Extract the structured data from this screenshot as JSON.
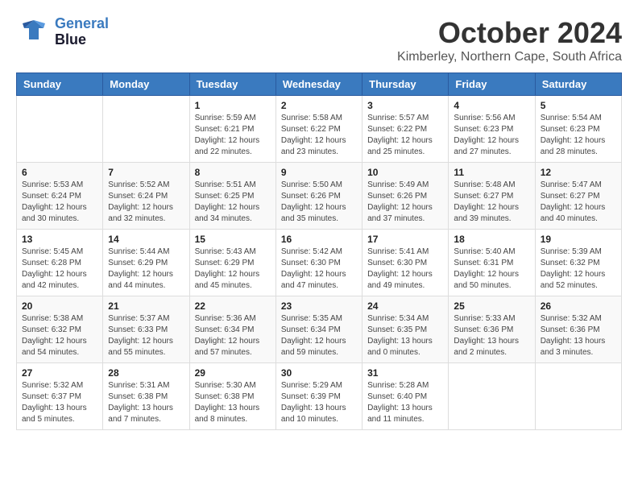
{
  "header": {
    "logo_line1": "General",
    "logo_line2": "Blue",
    "month": "October 2024",
    "location": "Kimberley, Northern Cape, South Africa"
  },
  "days_of_week": [
    "Sunday",
    "Monday",
    "Tuesday",
    "Wednesday",
    "Thursday",
    "Friday",
    "Saturday"
  ],
  "weeks": [
    [
      {
        "day": "",
        "info": ""
      },
      {
        "day": "",
        "info": ""
      },
      {
        "day": "1",
        "info": "Sunrise: 5:59 AM\nSunset: 6:21 PM\nDaylight: 12 hours\nand 22 minutes."
      },
      {
        "day": "2",
        "info": "Sunrise: 5:58 AM\nSunset: 6:22 PM\nDaylight: 12 hours\nand 23 minutes."
      },
      {
        "day": "3",
        "info": "Sunrise: 5:57 AM\nSunset: 6:22 PM\nDaylight: 12 hours\nand 25 minutes."
      },
      {
        "day": "4",
        "info": "Sunrise: 5:56 AM\nSunset: 6:23 PM\nDaylight: 12 hours\nand 27 minutes."
      },
      {
        "day": "5",
        "info": "Sunrise: 5:54 AM\nSunset: 6:23 PM\nDaylight: 12 hours\nand 28 minutes."
      }
    ],
    [
      {
        "day": "6",
        "info": "Sunrise: 5:53 AM\nSunset: 6:24 PM\nDaylight: 12 hours\nand 30 minutes."
      },
      {
        "day": "7",
        "info": "Sunrise: 5:52 AM\nSunset: 6:24 PM\nDaylight: 12 hours\nand 32 minutes."
      },
      {
        "day": "8",
        "info": "Sunrise: 5:51 AM\nSunset: 6:25 PM\nDaylight: 12 hours\nand 34 minutes."
      },
      {
        "day": "9",
        "info": "Sunrise: 5:50 AM\nSunset: 6:26 PM\nDaylight: 12 hours\nand 35 minutes."
      },
      {
        "day": "10",
        "info": "Sunrise: 5:49 AM\nSunset: 6:26 PM\nDaylight: 12 hours\nand 37 minutes."
      },
      {
        "day": "11",
        "info": "Sunrise: 5:48 AM\nSunset: 6:27 PM\nDaylight: 12 hours\nand 39 minutes."
      },
      {
        "day": "12",
        "info": "Sunrise: 5:47 AM\nSunset: 6:27 PM\nDaylight: 12 hours\nand 40 minutes."
      }
    ],
    [
      {
        "day": "13",
        "info": "Sunrise: 5:45 AM\nSunset: 6:28 PM\nDaylight: 12 hours\nand 42 minutes."
      },
      {
        "day": "14",
        "info": "Sunrise: 5:44 AM\nSunset: 6:29 PM\nDaylight: 12 hours\nand 44 minutes."
      },
      {
        "day": "15",
        "info": "Sunrise: 5:43 AM\nSunset: 6:29 PM\nDaylight: 12 hours\nand 45 minutes."
      },
      {
        "day": "16",
        "info": "Sunrise: 5:42 AM\nSunset: 6:30 PM\nDaylight: 12 hours\nand 47 minutes."
      },
      {
        "day": "17",
        "info": "Sunrise: 5:41 AM\nSunset: 6:30 PM\nDaylight: 12 hours\nand 49 minutes."
      },
      {
        "day": "18",
        "info": "Sunrise: 5:40 AM\nSunset: 6:31 PM\nDaylight: 12 hours\nand 50 minutes."
      },
      {
        "day": "19",
        "info": "Sunrise: 5:39 AM\nSunset: 6:32 PM\nDaylight: 12 hours\nand 52 minutes."
      }
    ],
    [
      {
        "day": "20",
        "info": "Sunrise: 5:38 AM\nSunset: 6:32 PM\nDaylight: 12 hours\nand 54 minutes."
      },
      {
        "day": "21",
        "info": "Sunrise: 5:37 AM\nSunset: 6:33 PM\nDaylight: 12 hours\nand 55 minutes."
      },
      {
        "day": "22",
        "info": "Sunrise: 5:36 AM\nSunset: 6:34 PM\nDaylight: 12 hours\nand 57 minutes."
      },
      {
        "day": "23",
        "info": "Sunrise: 5:35 AM\nSunset: 6:34 PM\nDaylight: 12 hours\nand 59 minutes."
      },
      {
        "day": "24",
        "info": "Sunrise: 5:34 AM\nSunset: 6:35 PM\nDaylight: 13 hours\nand 0 minutes."
      },
      {
        "day": "25",
        "info": "Sunrise: 5:33 AM\nSunset: 6:36 PM\nDaylight: 13 hours\nand 2 minutes."
      },
      {
        "day": "26",
        "info": "Sunrise: 5:32 AM\nSunset: 6:36 PM\nDaylight: 13 hours\nand 3 minutes."
      }
    ],
    [
      {
        "day": "27",
        "info": "Sunrise: 5:32 AM\nSunset: 6:37 PM\nDaylight: 13 hours\nand 5 minutes."
      },
      {
        "day": "28",
        "info": "Sunrise: 5:31 AM\nSunset: 6:38 PM\nDaylight: 13 hours\nand 7 minutes."
      },
      {
        "day": "29",
        "info": "Sunrise: 5:30 AM\nSunset: 6:38 PM\nDaylight: 13 hours\nand 8 minutes."
      },
      {
        "day": "30",
        "info": "Sunrise: 5:29 AM\nSunset: 6:39 PM\nDaylight: 13 hours\nand 10 minutes."
      },
      {
        "day": "31",
        "info": "Sunrise: 5:28 AM\nSunset: 6:40 PM\nDaylight: 13 hours\nand 11 minutes."
      },
      {
        "day": "",
        "info": ""
      },
      {
        "day": "",
        "info": ""
      }
    ]
  ]
}
